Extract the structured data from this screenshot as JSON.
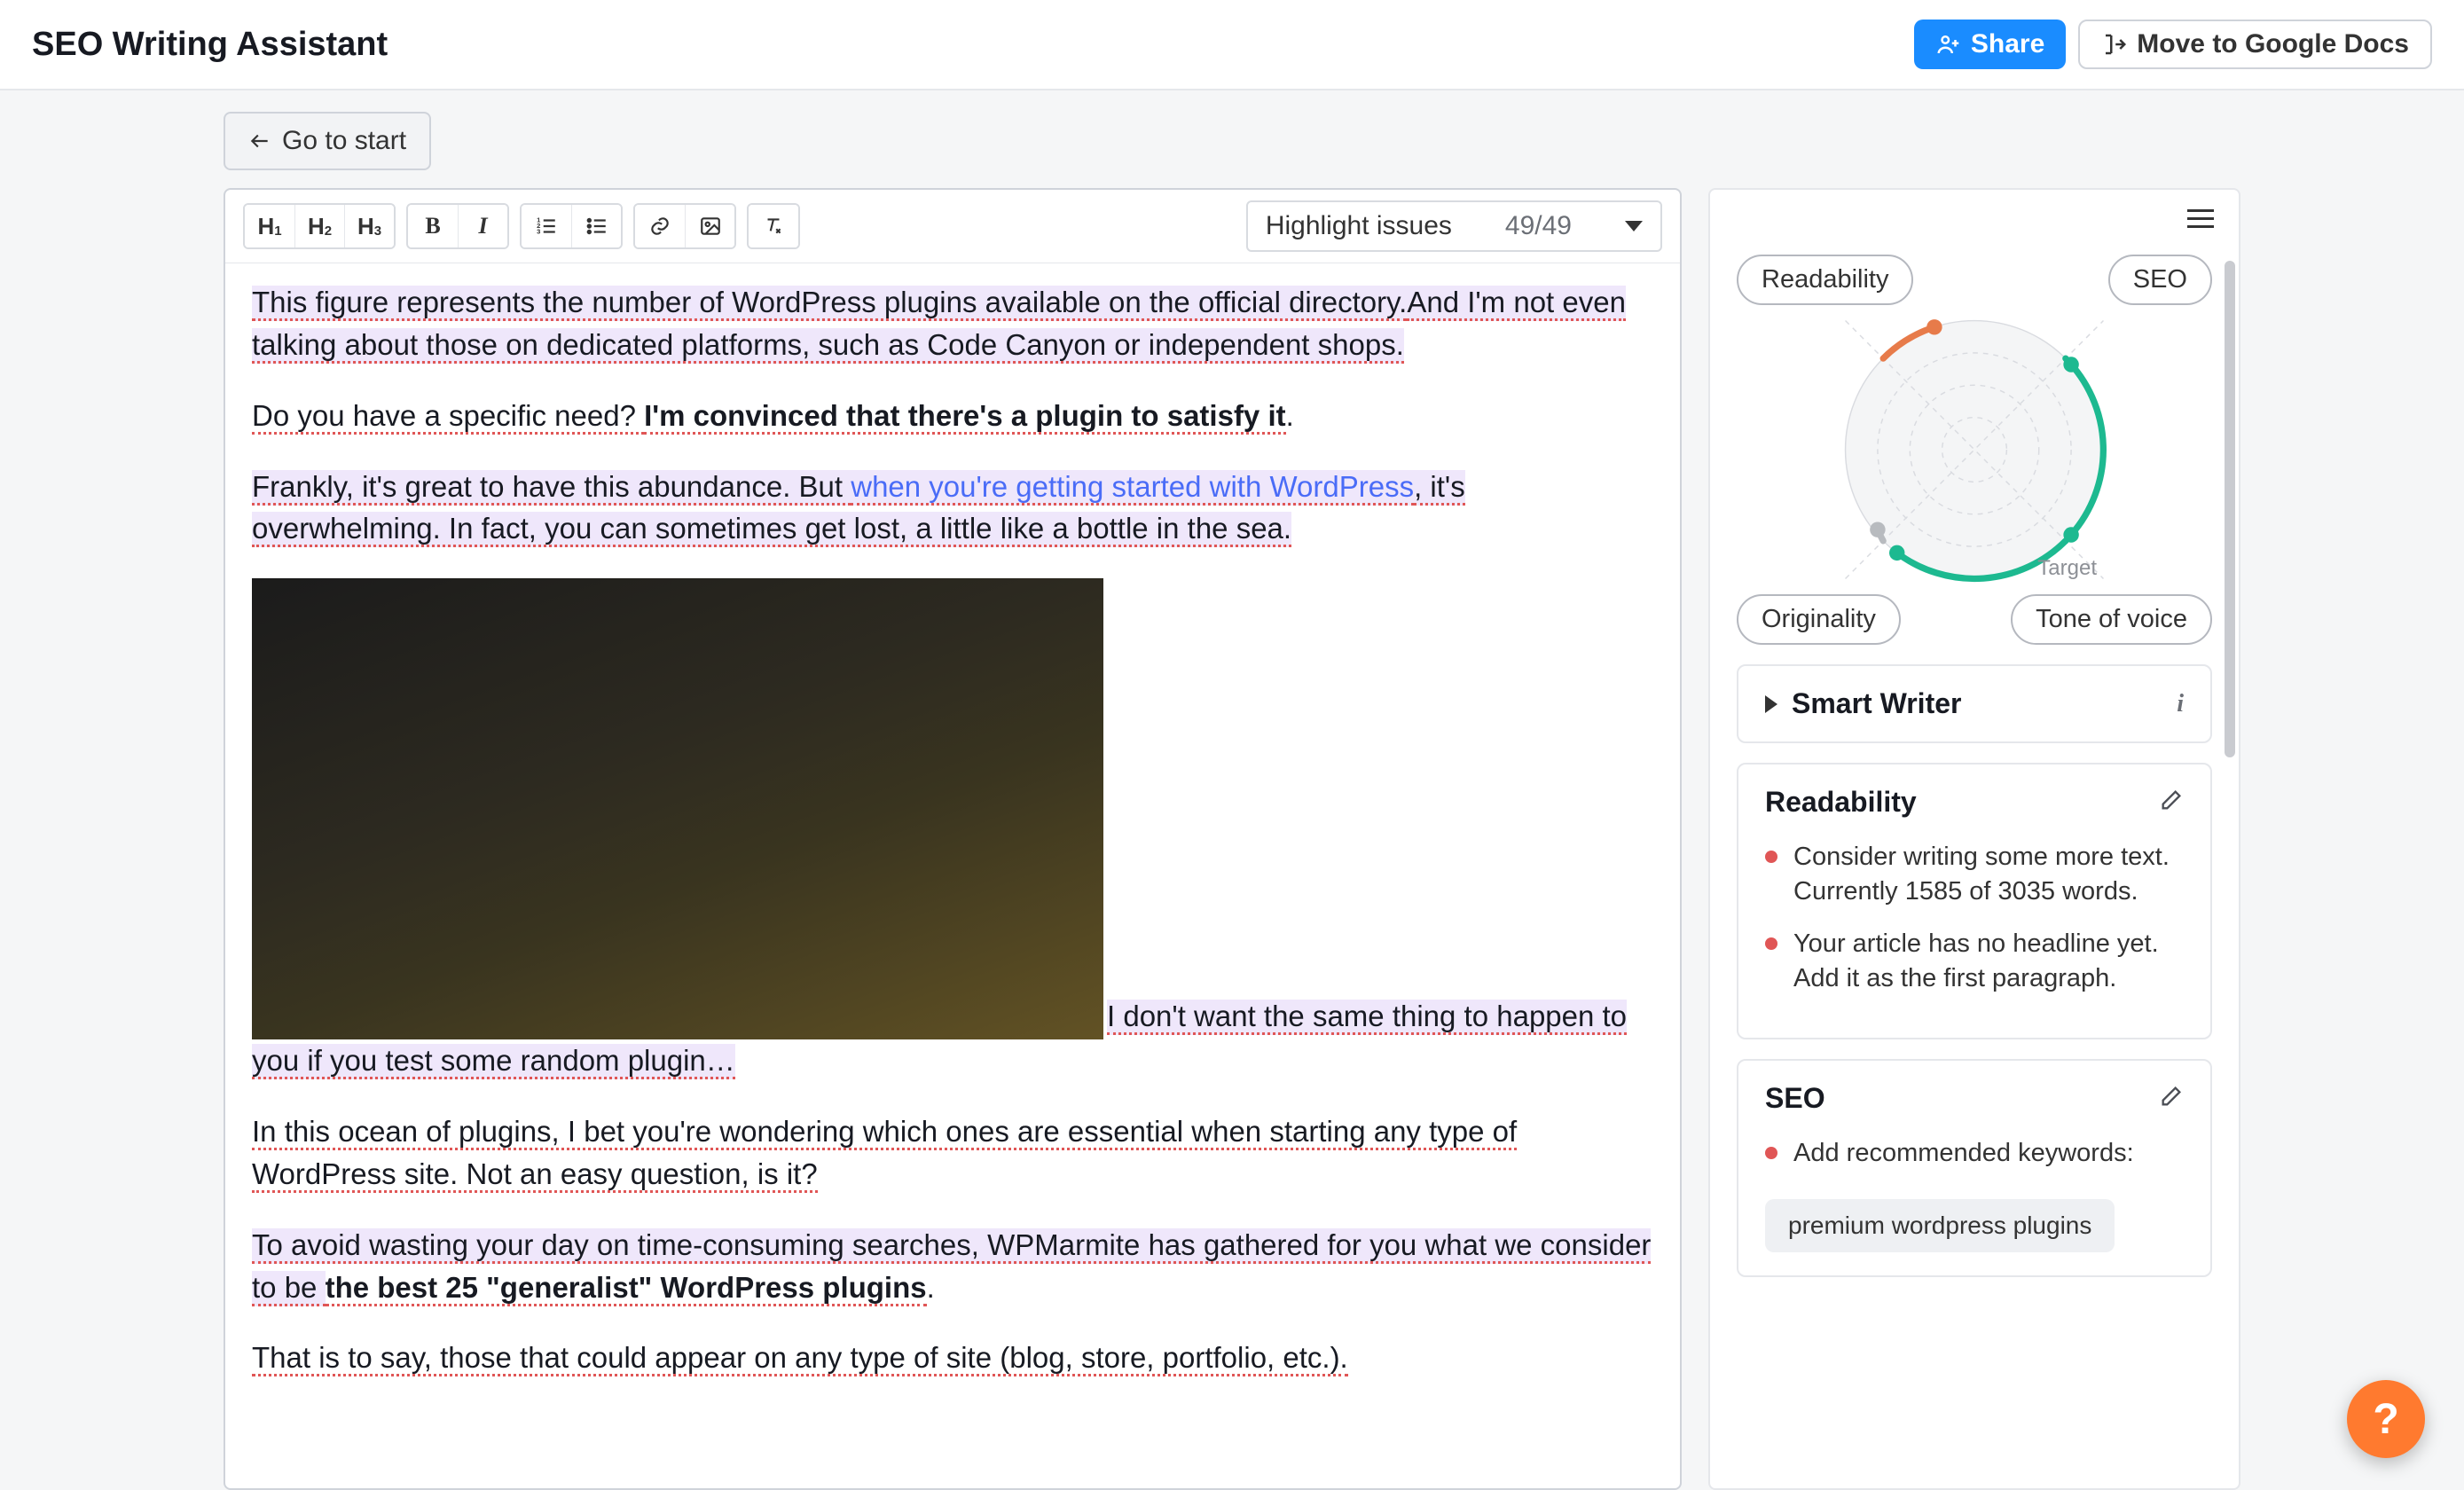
{
  "header": {
    "title": "SEO Writing Assistant",
    "share": "Share",
    "move": "Move to Google Docs"
  },
  "subbar": {
    "go_to_start": "Go to start"
  },
  "toolbar": {
    "h1": "H",
    "h1s": "1",
    "h2": "H",
    "h2s": "2",
    "h3": "H",
    "h3s": "3",
    "bold": "B",
    "italic": "I",
    "highlight_label": "Highlight issues",
    "highlight_count": "49/49"
  },
  "content": {
    "p1a": "This figure represents the number of WordPress plugins available on the official directory.",
    "p1b": "And I'm not even talking about those on dedicated platforms, such as Code Canyon or independent shops.",
    "p2a": "Do you have a specific need? ",
    "p2b": "I'm convinced that there's a plugin to satisfy it",
    "p2c": ".",
    "p3a": "Frankly, it's great to have this abundance. But ",
    "p3b": "when you're getting started with WordPress",
    "p3c": ", it's overwhelming. In fact, you can sometimes get lost, a little like a bottle in the sea.",
    "p4a": "I don't want the same thing to happen to you if you test some random plugin…",
    "p5": "In this ocean of plugins, I bet you're wondering which ones are essential when starting any type of WordPress site. Not an easy question, is it?",
    "p6a": "To avoid wasting your day on time-consuming searches, WPMarmite has gathered for you what we consider to be ",
    "p6b": "the best 25 \"generalist\" WordPress plugins",
    "p6c": ".",
    "p7": "That is to say, those that could appear on any type of site (blog, store, portfolio, etc.)."
  },
  "sidebar": {
    "pills": {
      "readability": "Readability",
      "seo": "SEO",
      "originality": "Originality",
      "tone": "Tone of voice"
    },
    "target": "Target",
    "smart_writer": "Smart Writer",
    "readability": {
      "title": "Readability",
      "i1": "Consider writing some more text. Currently 1585 of 3035 words.",
      "i2": "Your article has no headline yet. Add it as the first paragraph."
    },
    "seo": {
      "title": "SEO",
      "i1": "Add recommended keywords:",
      "kw1": "premium wordpress plugins"
    }
  },
  "fab": "?",
  "chart_data": {
    "type": "radar",
    "axes": [
      "Readability",
      "SEO",
      "Tone of voice",
      "Originality"
    ],
    "values_pct": [
      40,
      95,
      90,
      10
    ],
    "target_marker_axis": "Tone of voice",
    "segment_colors": [
      "#e77b4a",
      "#1db990",
      "#1db990",
      "#b8bbbf"
    ]
  }
}
